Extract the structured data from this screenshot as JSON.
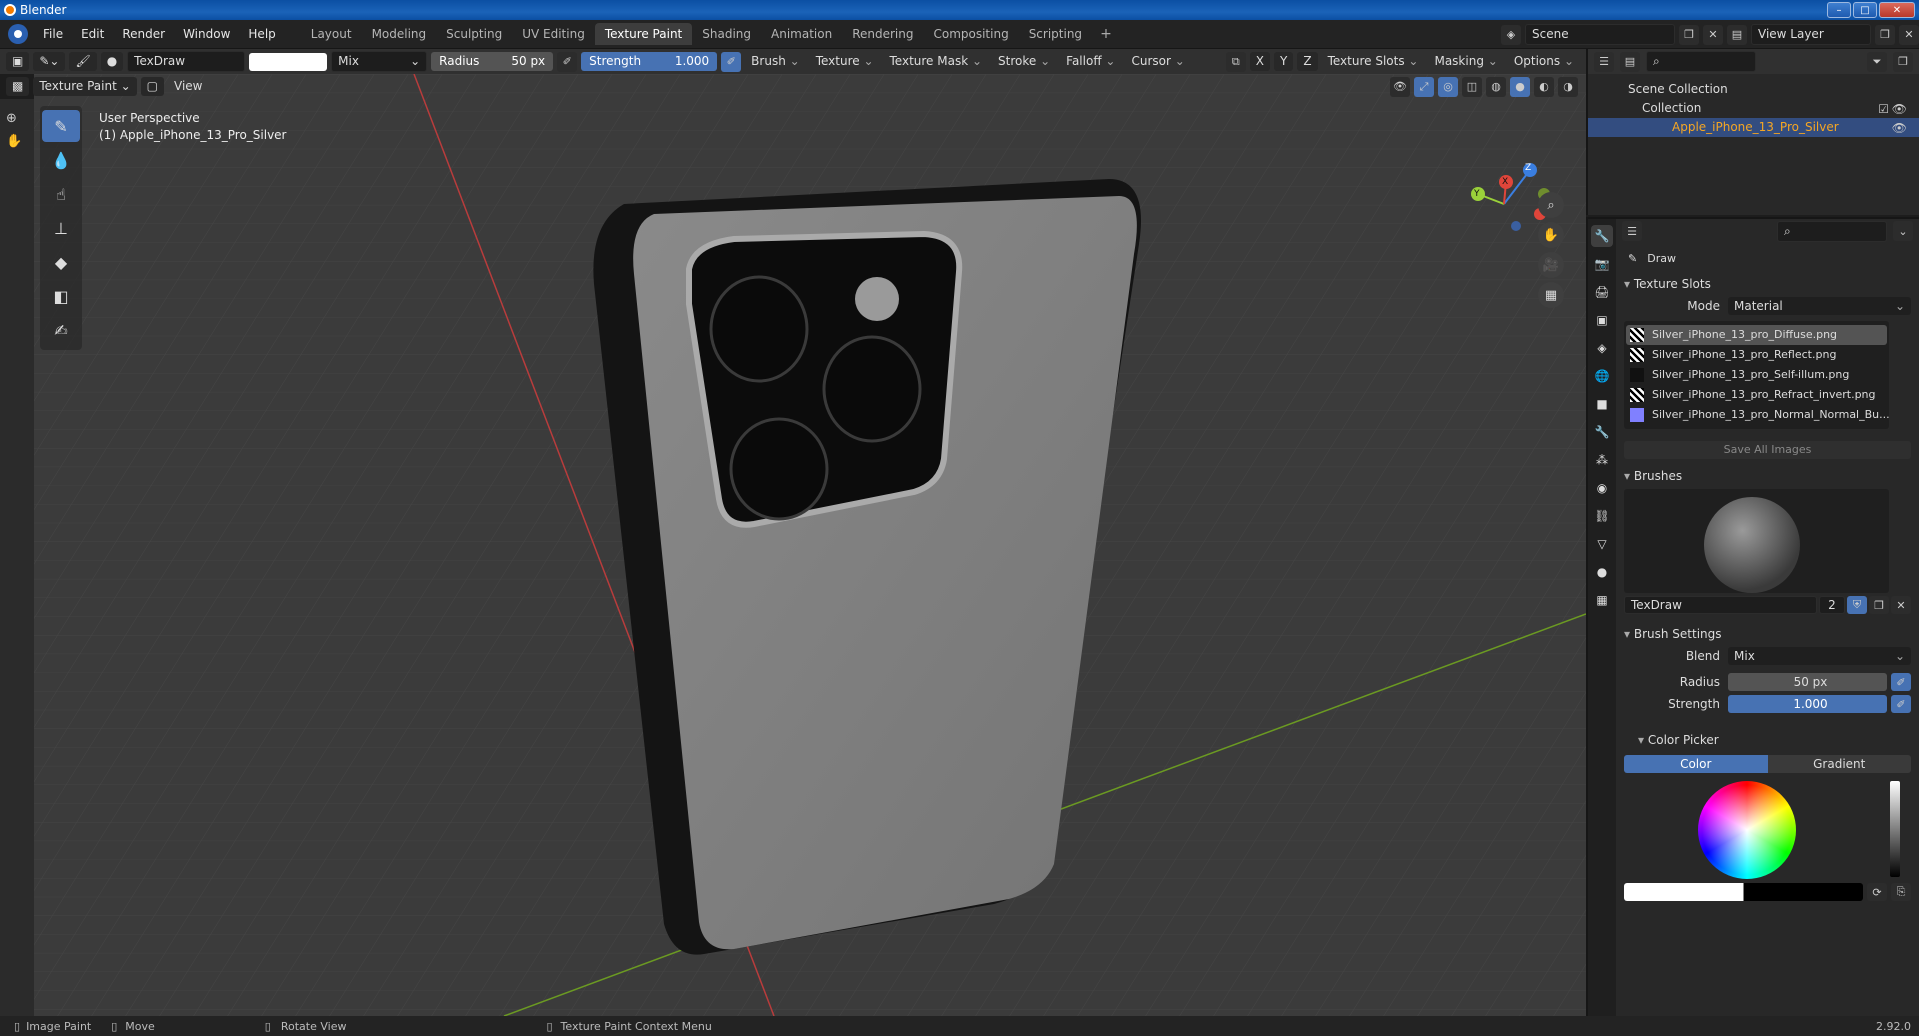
{
  "window": {
    "title": "Blender"
  },
  "menu": [
    "File",
    "Edit",
    "Render",
    "Window",
    "Help"
  ],
  "workspaces": [
    "Layout",
    "Modeling",
    "Sculpting",
    "UV Editing",
    "Texture Paint",
    "Shading",
    "Animation",
    "Rendering",
    "Compositing",
    "Scripting"
  ],
  "active_workspace": "Texture Paint",
  "scene": {
    "name": "Scene",
    "view_layer": "View Layer"
  },
  "tool_header": {
    "brush_name": "TexDraw",
    "blend": "Mix",
    "radius_label": "Radius",
    "radius_value": "50 px",
    "strength_label": "Strength",
    "strength_value": "1.000",
    "menus": [
      "Brush",
      "Texture",
      "Texture Mask",
      "Stroke",
      "Falloff",
      "Cursor"
    ],
    "axes": [
      "X",
      "Y",
      "Z"
    ],
    "right_menus": [
      "Texture Slots",
      "Masking",
      "Options"
    ]
  },
  "viewport_header": {
    "mode": "Texture Paint",
    "view": "View"
  },
  "viewport": {
    "perspective": "User Perspective",
    "object": "(1) Apple_iPhone_13_Pro_Silver",
    "gizmo": {
      "x": "X",
      "y": "Y",
      "z": "Z"
    }
  },
  "outliner": {
    "scene_collection": "Scene Collection",
    "collection": "Collection",
    "object": "Apple_iPhone_13_Pro_Silver"
  },
  "properties": {
    "tool": "Draw",
    "texture_slots": {
      "title": "Texture Slots",
      "mode_label": "Mode",
      "mode_value": "Material",
      "slots": [
        "Silver_iPhone_13_pro_Diffuse.png",
        "Silver_iPhone_13_pro_Reflect.png",
        "Silver_iPhone_13_pro_Self-illum.png",
        "Silver_iPhone_13_pro_Refract_invert.png",
        "Silver_iPhone_13_pro_Normal_Normal_Bu..."
      ],
      "save_all": "Save All Images"
    },
    "brushes": {
      "title": "Brushes",
      "brush_name": "TexDraw",
      "users": "2"
    },
    "brush_settings": {
      "title": "Brush Settings",
      "blend_label": "Blend",
      "blend_value": "Mix",
      "radius_label": "Radius",
      "radius_value": "50 px",
      "strength_label": "Strength",
      "strength_value": "1.000"
    },
    "color_picker": {
      "title": "Color Picker",
      "tab_color": "Color",
      "tab_gradient": "Gradient"
    }
  },
  "statusbar": {
    "items": [
      "Image Paint",
      "Move",
      "Rotate View",
      "Texture Paint Context Menu"
    ],
    "version": "2.92.0"
  }
}
